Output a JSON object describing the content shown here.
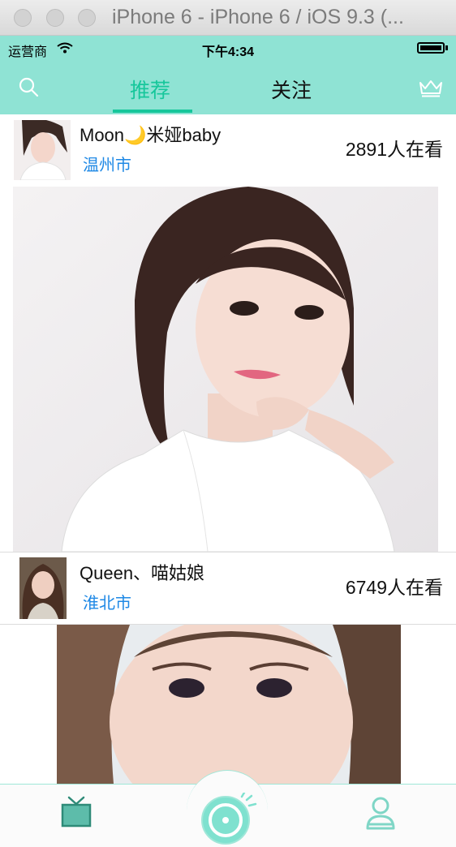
{
  "window": {
    "title": "iPhone 6 - iPhone 6 / iOS 9.3 (..."
  },
  "status_bar": {
    "carrier": "运营商",
    "time": "下午4:34"
  },
  "nav": {
    "tabs": [
      {
        "label": "推荐",
        "active": true
      },
      {
        "label": "关注",
        "active": false
      }
    ],
    "accent_color": "#16c79b",
    "background_color": "#8fe3d4"
  },
  "feed": [
    {
      "name": "Moon🌙米娅baby",
      "city": "温州市",
      "viewers": "2891人在看"
    },
    {
      "name": "Queen、喵姑娘",
      "city": "淮北市",
      "viewers": "6749人在看"
    }
  ],
  "tabbar": {
    "icons": [
      "tv-icon",
      "camera-record-icon",
      "profile-icon"
    ]
  }
}
